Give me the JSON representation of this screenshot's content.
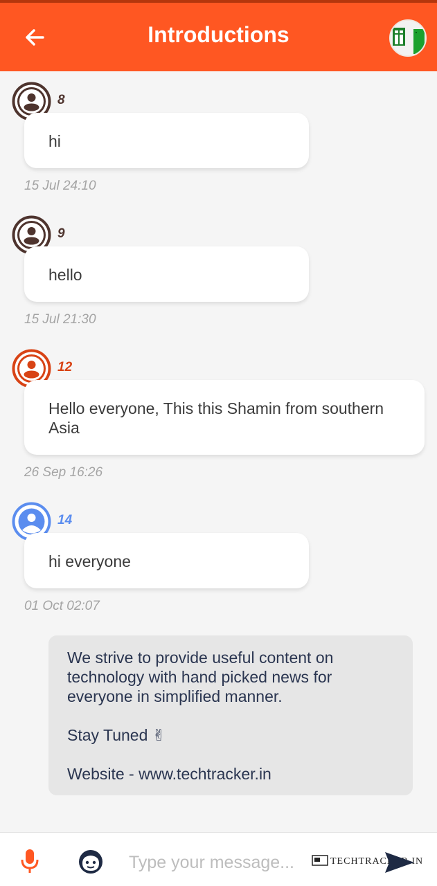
{
  "header": {
    "title": "Introductions",
    "accent_color": "#ff5722",
    "back_icon": "arrow-left-icon",
    "group_icon": "group-avatar"
  },
  "messages": [
    {
      "sender": "8",
      "text": "hi",
      "time": "15 Jul 24:10",
      "avatar_color": "#4e342e"
    },
    {
      "sender": "9",
      "text": "hello",
      "time": "15 Jul 21:30",
      "avatar_color": "#4e342e"
    },
    {
      "sender": "12",
      "text": "Hello everyone, This this Shamin from southern Asia",
      "time": "26 Sep 16:26",
      "avatar_color": "#d84315"
    },
    {
      "sender": "14",
      "text": "hi everyone",
      "time": "01 Oct 02:07",
      "avatar_color": "#5b8def"
    }
  ],
  "notice": {
    "line1": "We strive to provide useful content on technology with hand picked news for everyone in simplified manner.",
    "line2": "Stay Tuned ✌",
    "line3": "Website - www.techtracker.in"
  },
  "composer": {
    "placeholder": "Type your message...",
    "mic_icon": "microphone-icon",
    "emoji_icon": "emoji-icon",
    "send_icon": "send-icon",
    "watermark": "TECHTRACKER.IN"
  }
}
